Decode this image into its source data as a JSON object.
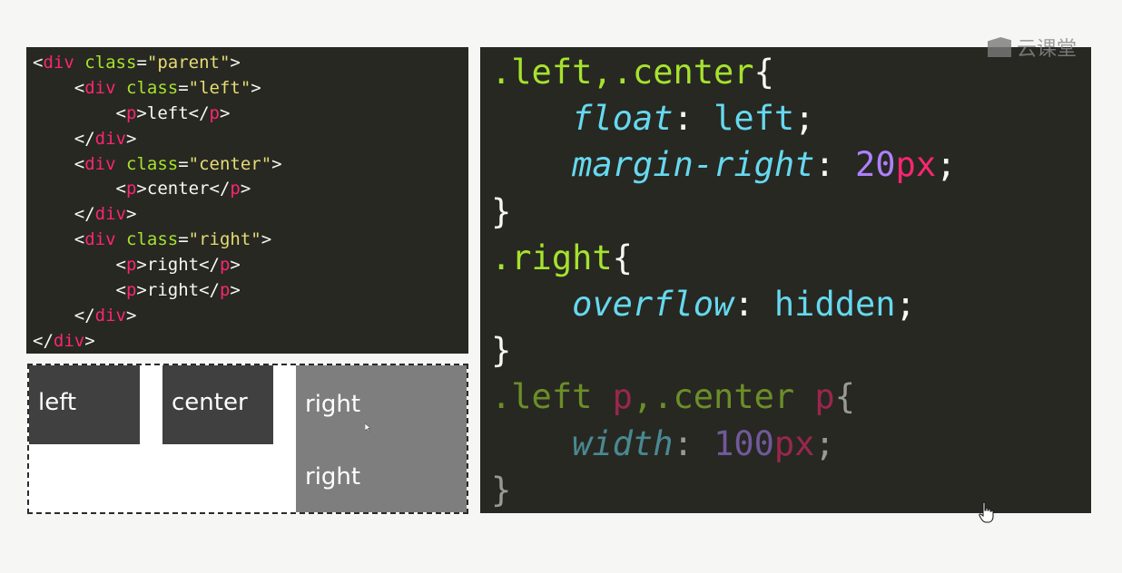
{
  "html_code": {
    "lines": [
      [
        [
          "pun",
          "<"
        ],
        [
          "tag",
          "div"
        ],
        [
          "txt",
          " "
        ],
        [
          "attr",
          "class"
        ],
        [
          "pun",
          "="
        ],
        [
          "str",
          "\"parent\""
        ],
        [
          "pun",
          ">"
        ]
      ],
      [
        [
          "txt",
          "    "
        ],
        [
          "pun",
          "<"
        ],
        [
          "tag",
          "div"
        ],
        [
          "txt",
          " "
        ],
        [
          "attr",
          "class"
        ],
        [
          "pun",
          "="
        ],
        [
          "str",
          "\"left\""
        ],
        [
          "pun",
          ">"
        ]
      ],
      [
        [
          "txt",
          "        "
        ],
        [
          "pun",
          "<"
        ],
        [
          "tag",
          "p"
        ],
        [
          "pun",
          ">"
        ],
        [
          "txt",
          "left"
        ],
        [
          "pun",
          "</"
        ],
        [
          "tag",
          "p"
        ],
        [
          "pun",
          ">"
        ]
      ],
      [
        [
          "txt",
          "    "
        ],
        [
          "pun",
          "</"
        ],
        [
          "tag",
          "div"
        ],
        [
          "pun",
          ">"
        ]
      ],
      [
        [
          "txt",
          "    "
        ],
        [
          "pun",
          "<"
        ],
        [
          "tag",
          "div"
        ],
        [
          "txt",
          " "
        ],
        [
          "attr",
          "class"
        ],
        [
          "pun",
          "="
        ],
        [
          "str",
          "\"center\""
        ],
        [
          "pun",
          ">"
        ]
      ],
      [
        [
          "txt",
          "        "
        ],
        [
          "pun",
          "<"
        ],
        [
          "tag",
          "p"
        ],
        [
          "pun",
          ">"
        ],
        [
          "txt",
          "center"
        ],
        [
          "pun",
          "</"
        ],
        [
          "tag",
          "p"
        ],
        [
          "pun",
          ">"
        ]
      ],
      [
        [
          "txt",
          "    "
        ],
        [
          "pun",
          "</"
        ],
        [
          "tag",
          "div"
        ],
        [
          "pun",
          ">"
        ]
      ],
      [
        [
          "txt",
          "    "
        ],
        [
          "pun",
          "<"
        ],
        [
          "tag",
          "div"
        ],
        [
          "txt",
          " "
        ],
        [
          "attr",
          "class"
        ],
        [
          "pun",
          "="
        ],
        [
          "str",
          "\"right\""
        ],
        [
          "pun",
          ">"
        ]
      ],
      [
        [
          "txt",
          "        "
        ],
        [
          "pun",
          "<"
        ],
        [
          "tag",
          "p"
        ],
        [
          "pun",
          ">"
        ],
        [
          "txt",
          "right"
        ],
        [
          "pun",
          "</"
        ],
        [
          "tag",
          "p"
        ],
        [
          "pun",
          ">"
        ]
      ],
      [
        [
          "txt",
          "        "
        ],
        [
          "pun",
          "<"
        ],
        [
          "tag",
          "p"
        ],
        [
          "pun",
          ">"
        ],
        [
          "txt",
          "right"
        ],
        [
          "pun",
          "</"
        ],
        [
          "tag",
          "p"
        ],
        [
          "pun",
          ">"
        ]
      ],
      [
        [
          "txt",
          "    "
        ],
        [
          "pun",
          "</"
        ],
        [
          "tag",
          "div"
        ],
        [
          "pun",
          ">"
        ]
      ],
      [
        [
          "pun",
          "</"
        ],
        [
          "tag",
          "div"
        ],
        [
          "pun",
          ">"
        ]
      ]
    ]
  },
  "demo": {
    "left_label": "left",
    "center_label": "center",
    "right_labels": [
      "right",
      "right"
    ]
  },
  "css_code": {
    "lines": [
      {
        "dim": false,
        "tokens": [
          [
            "css-sel",
            ".left,.center"
          ],
          [
            "css-pun",
            "{"
          ]
        ]
      },
      {
        "dim": false,
        "tokens": [
          [
            "css-pun",
            "    "
          ],
          [
            "css-prop",
            "float"
          ],
          [
            "css-pun",
            ": "
          ],
          [
            "css-val",
            "left"
          ],
          [
            "css-pun",
            ";"
          ]
        ]
      },
      {
        "dim": false,
        "tokens": [
          [
            "css-pun",
            "    "
          ],
          [
            "css-prop",
            "margin-right"
          ],
          [
            "css-pun",
            ": "
          ],
          [
            "css-num",
            "20"
          ],
          [
            "css-unit",
            "px"
          ],
          [
            "css-pun",
            ";"
          ]
        ]
      },
      {
        "dim": false,
        "tokens": [
          [
            "css-pun",
            "}"
          ]
        ]
      },
      {
        "dim": false,
        "tokens": [
          [
            "css-sel",
            ".right"
          ],
          [
            "css-pun",
            "{"
          ]
        ]
      },
      {
        "dim": false,
        "tokens": [
          [
            "css-pun",
            "    "
          ],
          [
            "css-prop",
            "overflow"
          ],
          [
            "css-pun",
            ": "
          ],
          [
            "css-val",
            "hidden"
          ],
          [
            "css-pun",
            ";"
          ]
        ]
      },
      {
        "dim": false,
        "tokens": [
          [
            "css-pun",
            "}"
          ]
        ]
      },
      {
        "dim": true,
        "tokens": [
          [
            "css-sel",
            ".left "
          ],
          [
            "css-tag",
            "p"
          ],
          [
            "css-sel",
            ",.center "
          ],
          [
            "css-tag",
            "p"
          ],
          [
            "css-pun",
            "{"
          ]
        ]
      },
      {
        "dim": true,
        "tokens": [
          [
            "css-pun",
            "    "
          ],
          [
            "css-prop",
            "width"
          ],
          [
            "css-pun",
            ": "
          ],
          [
            "css-num",
            "100"
          ],
          [
            "css-unit",
            "px"
          ],
          [
            "css-pun",
            ";"
          ]
        ]
      },
      {
        "dim": true,
        "tokens": [
          [
            "css-pun",
            "}"
          ]
        ]
      }
    ]
  },
  "watermark": {
    "text": "云课堂",
    "icon": "cloud-classroom-logo-icon"
  },
  "colors": {
    "editor_bg": "#272822",
    "tag": "#f92672",
    "attr": "#a6e22e",
    "string": "#e6db74",
    "property": "#66d9ef",
    "number": "#ae81ff",
    "demo_dark_block": "#404040",
    "demo_right_block": "#7e7e7e"
  }
}
